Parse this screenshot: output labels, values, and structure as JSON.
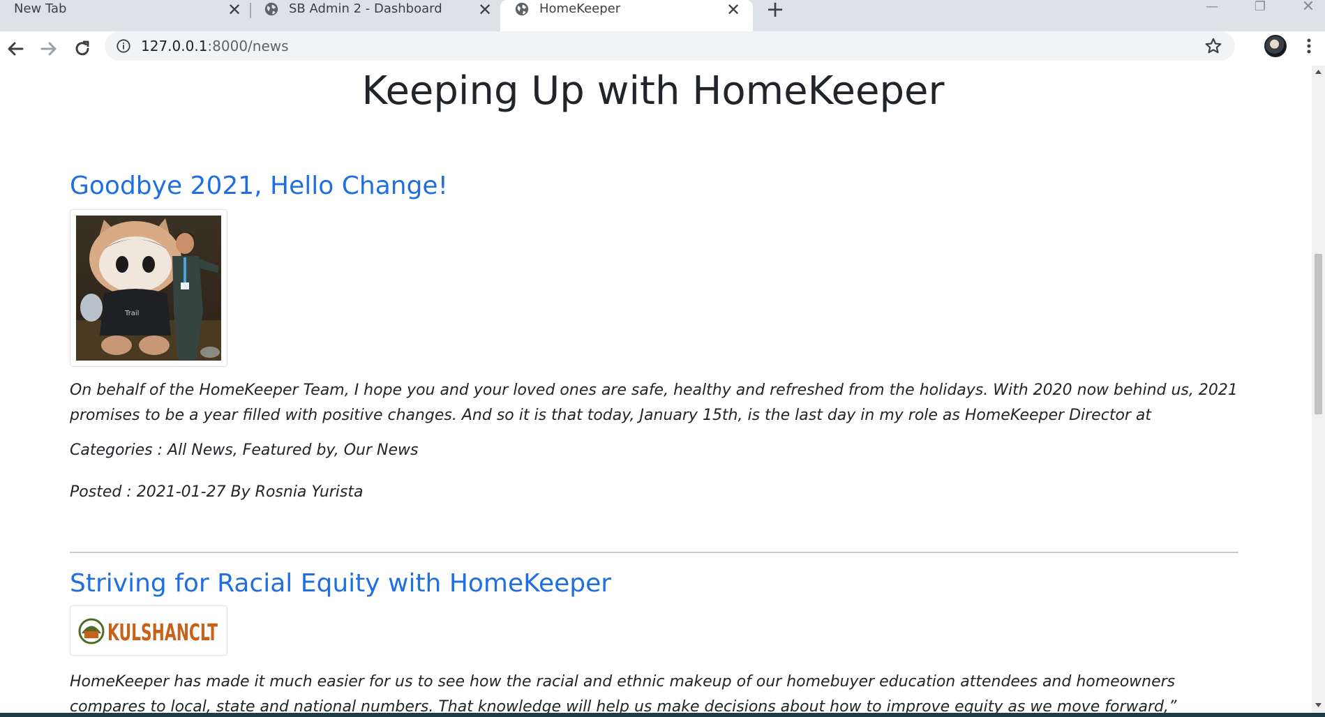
{
  "browser": {
    "tabs": [
      {
        "label": "New Tab",
        "active": false
      },
      {
        "label": "SB Admin 2 - Dashboard",
        "active": false
      },
      {
        "label": "HomeKeeper",
        "active": true
      }
    ],
    "url_host": "127.0.0.1",
    "url_rest": ":8000/news"
  },
  "page": {
    "title": "Keeping Up with HomeKeeper",
    "articles": [
      {
        "title": "Goodbye 2021, Hello Change!",
        "excerpt": "On behalf of the HomeKeeper Team, I hope you and your loved ones are safe, healthy and refreshed from the holidays. With 2020 now behind us, 2021 promises to be a year filled with positive changes. And so it is that today, January 15th, is the last day in my role as HomeKeeper Director at",
        "categories": "Categories : All News, Featured by, Our News",
        "posted": "Posted : 2021-01-27 By Rosnia Yurista"
      },
      {
        "title": "Striving for Racial Equity with HomeKeeper",
        "logo_text": "KULSHANCLT",
        "excerpt": "HomeKeeper has made it much easier for us to see how the racial and ethnic makeup of our homebuyer education attendees and homeowners compares to local, state and national numbers. That knowledge will help us make decisions about how to improve equity as we move forward,” explains Fearing. By Lorraine Wilde"
      }
    ]
  },
  "colors": {
    "link": "#1f6fe0",
    "logo_orange": "#c8621a",
    "logo_green": "#4f6a25"
  }
}
